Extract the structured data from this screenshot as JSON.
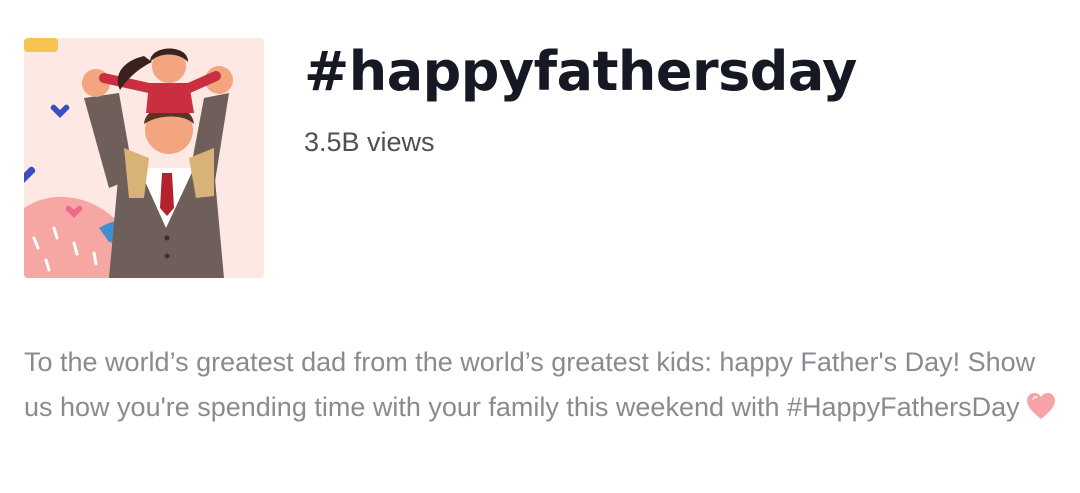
{
  "challenge": {
    "title": "#happyfathersday",
    "views": "3.5B views",
    "cover_icon": "father-carrying-child-illustration"
  },
  "description": {
    "text": "To the world’s greatest dad from the world’s greatest kids: happy Father's Day! Show us how you're spending time with your family this weekend with #HappyFathersDay",
    "emoji_icon": "pink-heart-icon"
  }
}
